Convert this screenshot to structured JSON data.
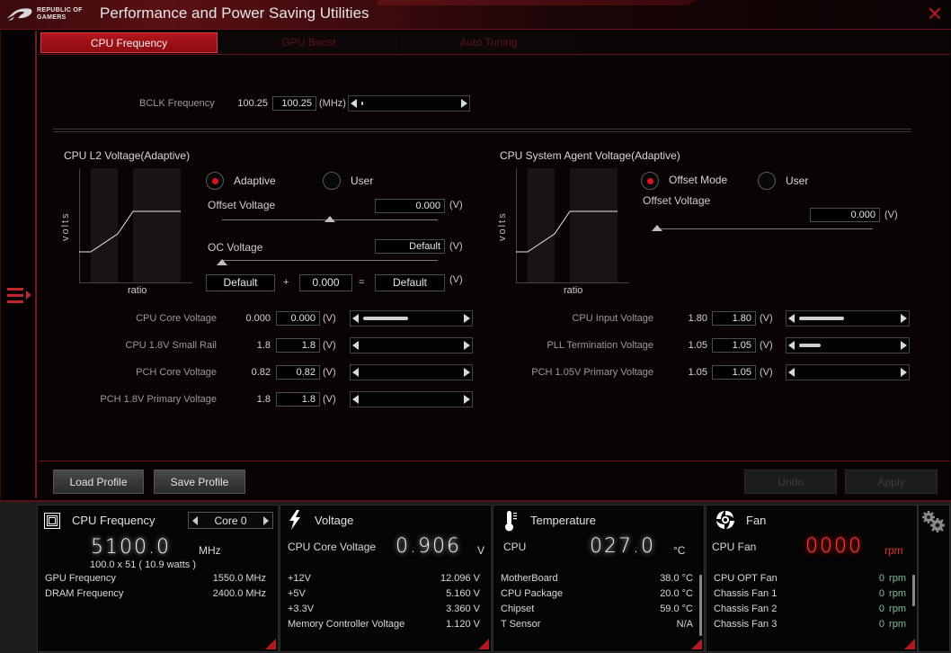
{
  "app": {
    "brand_line1": "REPUBLIC OF",
    "brand_line2": "GAMERS",
    "title": "Performance and Power Saving Utilities",
    "close_icon": "close-icon"
  },
  "tabs": [
    {
      "label": "CPU Frequency",
      "active": true
    },
    {
      "label": "GPU Boost",
      "active": false
    },
    {
      "label": "Auto Tuning",
      "active": false
    }
  ],
  "bclk": {
    "label": "BCLK Frequency",
    "current": "100.25",
    "input": "100.25",
    "unit": "(MHz)",
    "slider_fraction": 0.02
  },
  "l2": {
    "title": "CPU L2 Voltage(Adaptive)",
    "graph": {
      "ylabel": "volts",
      "xlabel": "ratio"
    },
    "mode_options": [
      {
        "label": "Adaptive",
        "selected": true
      },
      {
        "label": "User",
        "selected": false
      }
    ],
    "offset_label": "Offset Voltage",
    "offset_value": "0.000",
    "offset_slider_fraction": 0.5,
    "oc_label": "OC Voltage",
    "oc_value": "Default",
    "oc_slider_fraction": 0.0,
    "unit": "(V)",
    "sum": {
      "a": "Default",
      "plus": "+",
      "b": "0.000",
      "eq": "=",
      "result": "Default"
    }
  },
  "sa": {
    "title": "CPU System Agent Voltage(Adaptive)",
    "graph": {
      "ylabel": "volts",
      "xlabel": "ratio"
    },
    "mode_options": [
      {
        "label": "Offset Mode",
        "selected": true
      },
      {
        "label": "User",
        "selected": false
      }
    ],
    "offset_label": "Offset Voltage",
    "offset_value": "0.000",
    "offset_slider_fraction": 0.0,
    "unit": "(V)"
  },
  "left_voltages": [
    {
      "label": "CPU Core Voltage",
      "current": "0.000",
      "input": "0.000",
      "unit": "(V)",
      "fill": 0.42
    },
    {
      "label": "CPU 1.8V Small Rail",
      "current": "1.8",
      "input": "1.8",
      "unit": "(V)",
      "fill": 0
    },
    {
      "label": "PCH Core Voltage",
      "current": "0.82",
      "input": "0.82",
      "unit": "(V)",
      "fill": 0
    },
    {
      "label": "PCH 1.8V Primary Voltage",
      "current": "1.8",
      "input": "1.8",
      "unit": "(V)",
      "fill": 0
    }
  ],
  "right_voltages": [
    {
      "label": "CPU Input Voltage",
      "current": "1.80",
      "input": "1.80",
      "unit": "(V)",
      "fill": 0.42
    },
    {
      "label": "PLL Termination Voltage",
      "current": "1.05",
      "input": "1.05",
      "unit": "(V)",
      "fill": 0.2
    },
    {
      "label": "PCH 1.05V Primary Voltage",
      "current": "1.05",
      "input": "1.05",
      "unit": "(V)",
      "fill": 0
    }
  ],
  "buttons": {
    "load": "Load Profile",
    "save": "Save Profile",
    "undo": "Undo",
    "apply": "Apply"
  },
  "monitor": {
    "cpu": {
      "title": "CPU Frequency",
      "core": "Core 0",
      "value": "5100.0",
      "unit": "MHz",
      "detail": "100.0  x  51    ( 10.9   watts )",
      "rows": [
        {
          "label": "GPU Frequency",
          "value": "1550.0  MHz"
        },
        {
          "label": "DRAM Frequency",
          "value": "2400.0  MHz"
        }
      ]
    },
    "voltage": {
      "title": "Voltage",
      "main_label": "CPU Core Voltage",
      "value": "0.906",
      "unit": "V",
      "rows": [
        {
          "label": "+12V",
          "value": "12.096  V"
        },
        {
          "label": "+5V",
          "value": "5.160  V"
        },
        {
          "label": "+3.3V",
          "value": "3.360  V"
        },
        {
          "label": "Memory Controller Voltage",
          "value": "1.120  V"
        }
      ]
    },
    "temperature": {
      "title": "Temperature",
      "main_label": "CPU",
      "value": "027.0",
      "unit": "°C",
      "rows": [
        {
          "label": "MotherBoard",
          "value": "38.0 °C"
        },
        {
          "label": "CPU Package",
          "value": "20.0 °C"
        },
        {
          "label": "Chipset",
          "value": "59.0 °C"
        },
        {
          "label": "T Sensor",
          "value": "N/A"
        }
      ]
    },
    "fan": {
      "title": "Fan",
      "main_label": "CPU Fan",
      "value": "0000",
      "unit": "rpm",
      "rows": [
        {
          "label": "CPU OPT Fan",
          "value": "0",
          "unit": "rpm"
        },
        {
          "label": "Chassis Fan 1",
          "value": "0",
          "unit": "rpm"
        },
        {
          "label": "Chassis Fan 2",
          "value": "0",
          "unit": "rpm"
        },
        {
          "label": "Chassis Fan 3",
          "value": "0",
          "unit": "rpm"
        }
      ]
    }
  },
  "colors": {
    "accent": "#b3141b",
    "fan_value": "#7fbf9f",
    "fan_main": "#ff4040"
  }
}
